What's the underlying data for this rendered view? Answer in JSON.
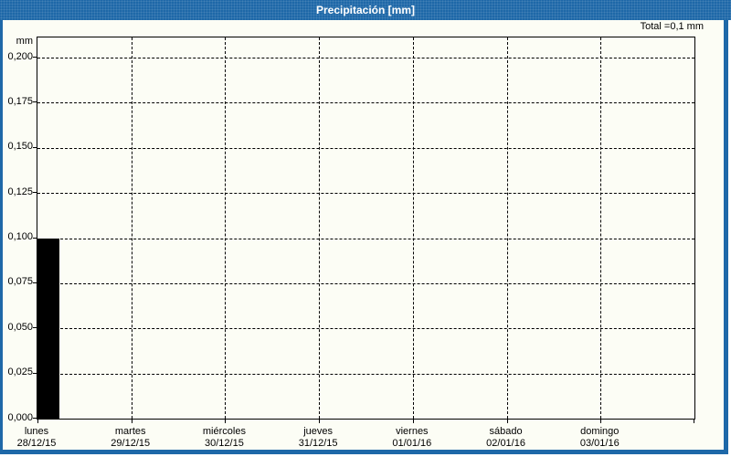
{
  "ui": {
    "titlebar_color": "#1E68A8",
    "window_background": "#FCFDF5",
    "border_color": "#1E68A8",
    "grid_color": "#000000"
  },
  "chart_data": {
    "type": "bar",
    "title": "Precipitación [mm]",
    "total_label": "Total =0,1 mm",
    "ylabel": "mm",
    "xlabel": "",
    "ylim": [
      0,
      0.211
    ],
    "grid": "dashed",
    "legend_position": "none",
    "bar_color": "#000000",
    "yticks": [
      {
        "label": "0,200",
        "value": 0.2
      },
      {
        "label": "0,175",
        "value": 0.175
      },
      {
        "label": "0,150",
        "value": 0.15
      },
      {
        "label": "0,125",
        "value": 0.125
      },
      {
        "label": "0,100",
        "value": 0.1
      },
      {
        "label": "0,075",
        "value": 0.075
      },
      {
        "label": "0,050",
        "value": 0.05
      },
      {
        "label": "0,025",
        "value": 0.025
      },
      {
        "label": "0,000",
        "value": 0.0
      }
    ],
    "categories": [
      "lunes",
      "martes",
      "miércoles",
      "jueves",
      "viernes",
      "sábado",
      "domingo"
    ],
    "dates": [
      "28/12/15",
      "29/12/15",
      "30/12/15",
      "31/12/15",
      "01/01/16",
      "02/01/16",
      "03/01/16"
    ],
    "values": [
      0.1,
      0,
      0,
      0,
      0,
      0,
      0
    ]
  }
}
